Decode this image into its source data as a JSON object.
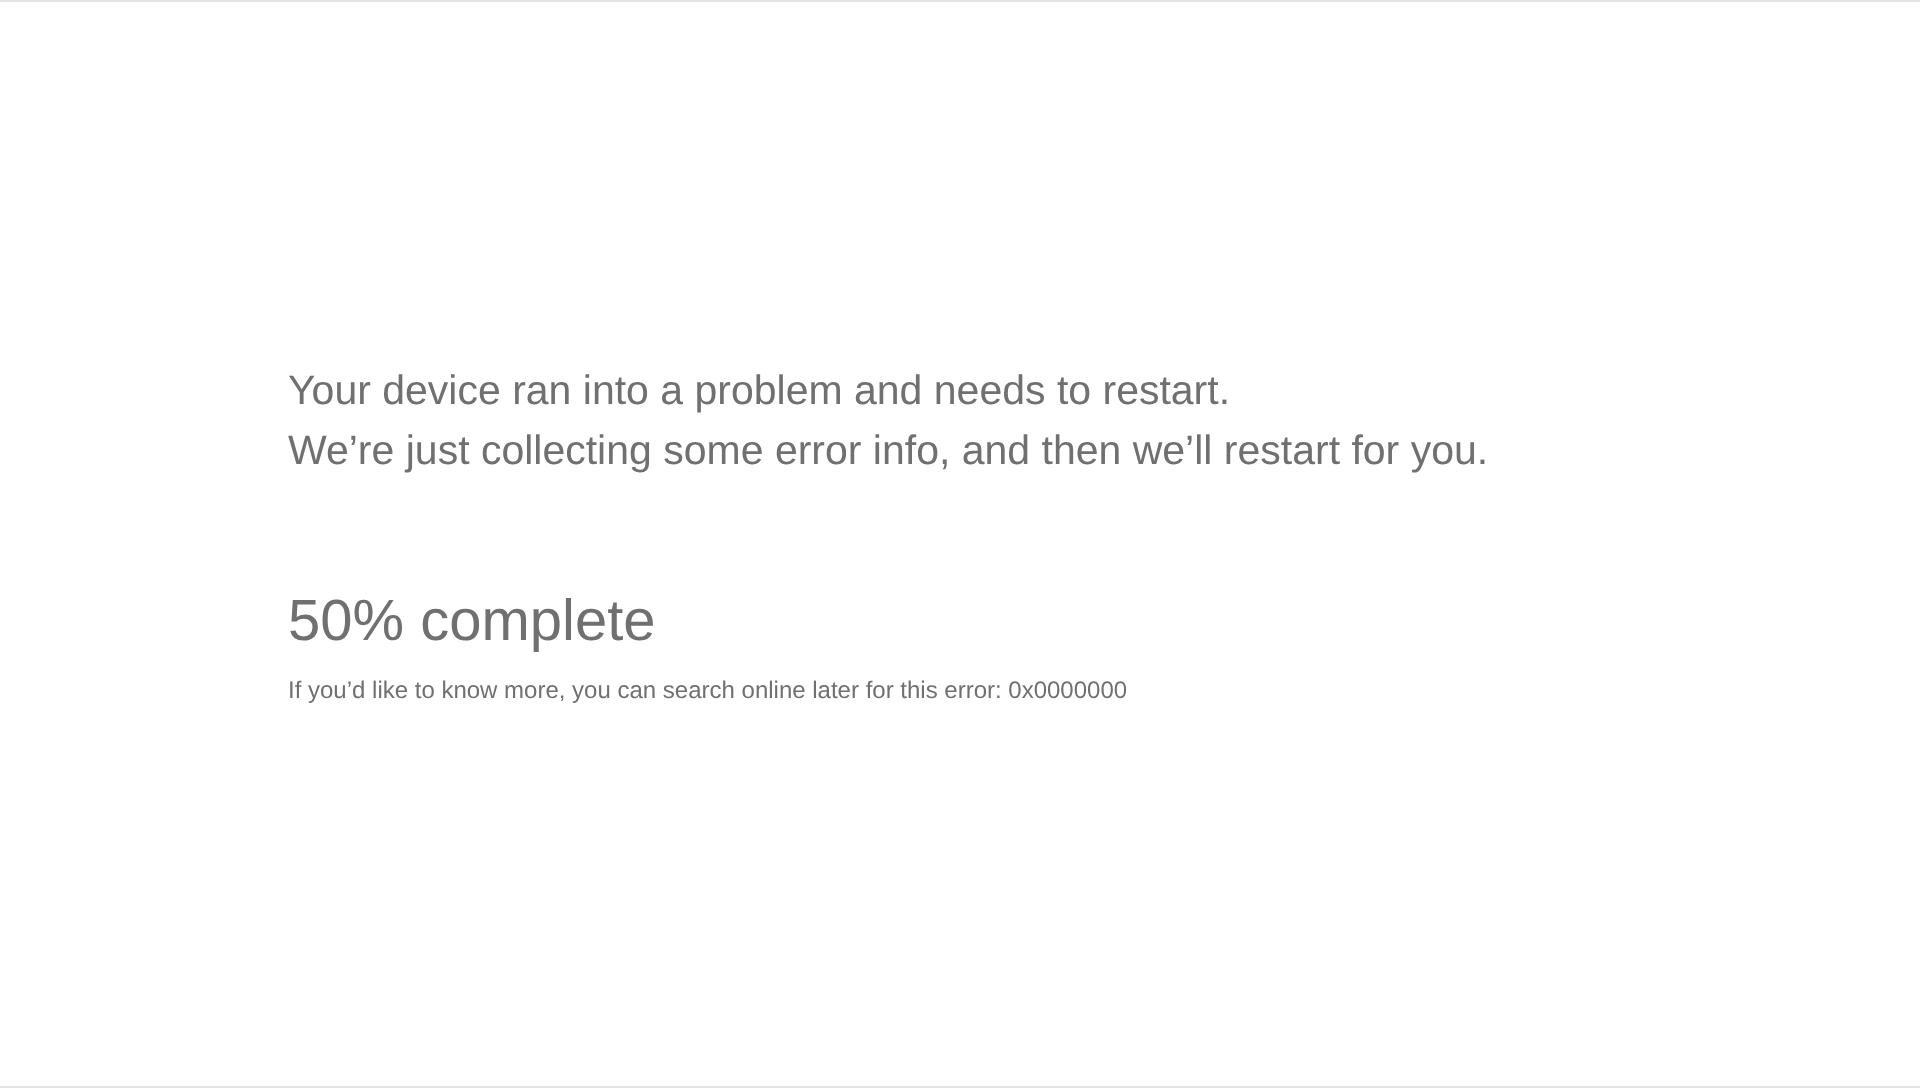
{
  "message_lines": [
    "Your device ran into a problem and needs to restart.",
    "We’re just collecting some error info, and then we’ll restart for you."
  ],
  "progress_text": "50% complete",
  "info_text": "If you’d like to know more, you can search online later for this error: 0x0000000"
}
